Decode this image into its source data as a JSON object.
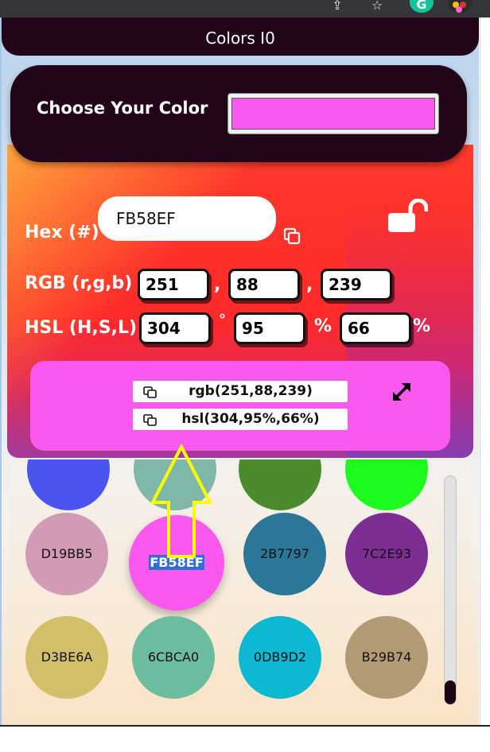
{
  "window": {
    "title": "Colors I0"
  },
  "chooser": {
    "label": "Choose Your Color",
    "value_color": "#fb58ef"
  },
  "hex": {
    "label": "Hex (#)",
    "value": "FB58EF"
  },
  "rgb": {
    "label": "RGB (r,g,b)",
    "r": "251",
    "g": "88",
    "b": "239",
    "sep1": ",",
    "sep2": ","
  },
  "hsl": {
    "label": "HSL (H,S,L)",
    "h": "304",
    "s": "95",
    "l": "66",
    "unit_h": "°",
    "unit_s": "%",
    "unit_l": "%"
  },
  "preview": {
    "color": "#fb58ef",
    "rgb_text": "rgb(251,88,239)",
    "hsl_text": "hsl(304,95%,66%)"
  },
  "palette": {
    "top_partial": [
      "#4a54ee",
      "#7fb7a8",
      "#4c8a2e",
      "#1dfa1d"
    ],
    "row1": [
      {
        "label": "D19BB5",
        "color": "#d19bb5"
      },
      {
        "label": "FB58EF",
        "color": "#fb58ef"
      },
      {
        "label": "2B7797",
        "color": "#2b7797"
      },
      {
        "label": "7C2E93",
        "color": "#7c2e93"
      }
    ],
    "row2": [
      {
        "label": "D3BE6A",
        "color": "#d3be6a"
      },
      {
        "label": "6CBCA0",
        "color": "#6cbca0"
      },
      {
        "label": "0DB9D2",
        "color": "#0db9d2"
      },
      {
        "label": "B29B74",
        "color": "#b29b74"
      }
    ]
  },
  "icons": {
    "copy": "copy-icon",
    "lock": "unlock-icon",
    "expand": "expand-icon",
    "arrow": "up-arrow-annotation"
  },
  "accent": {
    "arrow_color": "#ffff00",
    "dark": "#220518"
  }
}
